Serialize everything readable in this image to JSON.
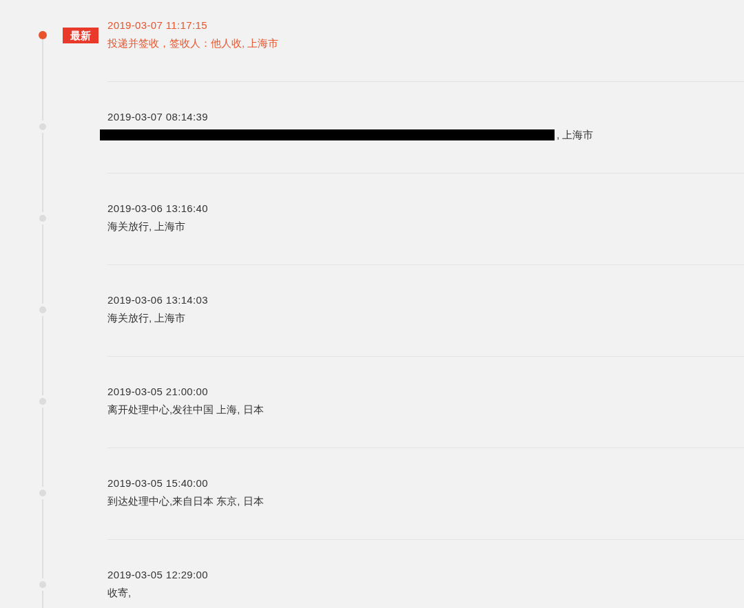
{
  "events": [
    {
      "time": "2019-03-07 11:17:15",
      "description": "投递并签收，签收人：他人收, 上海市",
      "badge": "最新",
      "latest": true,
      "redacted": false
    },
    {
      "time": "2019-03-07 08:14:39",
      "description": ", 上海市",
      "latest": false,
      "redacted": true
    },
    {
      "time": "2019-03-06 13:16:40",
      "description": "海关放行, 上海市",
      "latest": false,
      "redacted": false
    },
    {
      "time": "2019-03-06 13:14:03",
      "description": "海关放行, 上海市",
      "latest": false,
      "redacted": false
    },
    {
      "time": "2019-03-05 21:00:00",
      "description": "离开处理中心,发往中国 上海, 日本",
      "latest": false,
      "redacted": false
    },
    {
      "time": "2019-03-05 15:40:00",
      "description": "到达处理中心,来自日本 东京, 日本",
      "latest": false,
      "redacted": false
    },
    {
      "time": "2019-03-05 12:29:00",
      "description": "收寄,",
      "latest": false,
      "redacted": false
    }
  ]
}
